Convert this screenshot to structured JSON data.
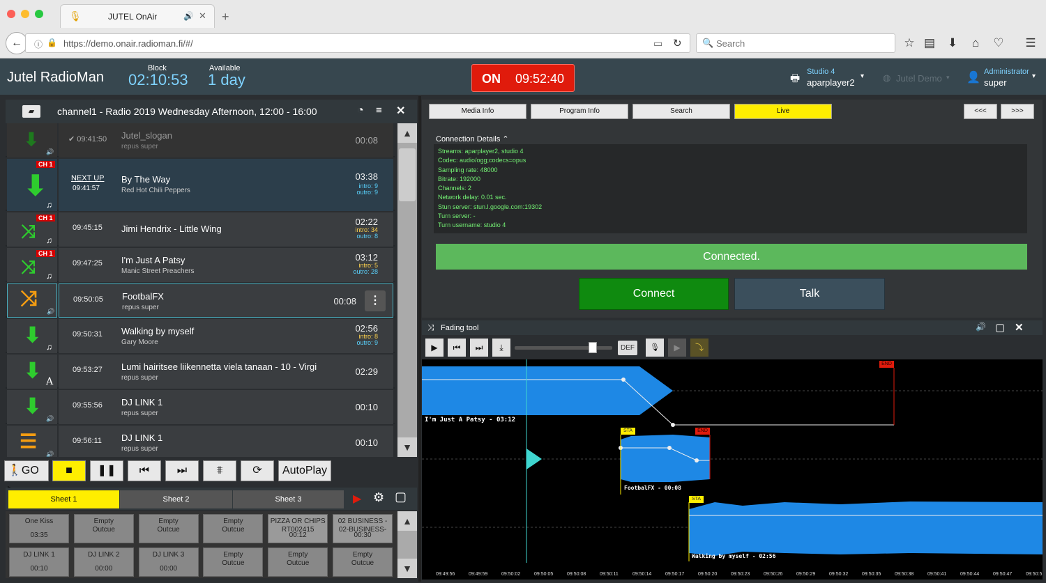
{
  "browser": {
    "tab_title": "JUTEL OnAir",
    "url": "https://demo.onair.radioman.fi/#/",
    "search_placeholder": "Search"
  },
  "header": {
    "brand": "Jutel RadioMan",
    "block_label": "Block",
    "block_value": "02:10:53",
    "available_label": "Available",
    "available_value": "1 day",
    "onair_label": "ON",
    "onair_time": "09:52:40",
    "studio_label": "Studio 4",
    "studio_value": "aparplayer2",
    "demo_label": "Jutel Demo",
    "user_label": "Administrator",
    "user_value": "super"
  },
  "playlist": {
    "title": "channel1 - Radio 2019 Wednesday Afternoon, 12:00 - 16:00",
    "ch_badge": "CH 1",
    "next_up": "NEXT UP",
    "rows": [
      {
        "time": "09:41:50",
        "title": "Jutel_slogan",
        "sub": "repus super",
        "dur": "00:08"
      },
      {
        "time": "09:41:57",
        "title": "By The Way",
        "sub": "Red Hot Chili Peppers",
        "dur": "03:38",
        "intro": "intro: 9",
        "outro": "outro: 9"
      },
      {
        "time": "09:45:15",
        "title": "Jimi Hendrix - Little Wing",
        "sub": "",
        "dur": "02:22",
        "intro": "intro: 34",
        "outro": "outro: 8"
      },
      {
        "time": "09:47:25",
        "title": "I'm Just A Patsy",
        "sub": "Manic Street Preachers",
        "dur": "03:12",
        "intro": "intro: 5",
        "outro": "outro: 28"
      },
      {
        "time": "09:50:05",
        "title": "FootbalFX",
        "sub": "repus super",
        "dur": "00:08"
      },
      {
        "time": "09:50:31",
        "title": "Walking by myself",
        "sub": "Gary Moore",
        "dur": "02:56",
        "intro": "intro: 8",
        "outro": "outro: 9"
      },
      {
        "time": "09:53:27",
        "title": "Lumi hairitsee liikennetta viela tanaan - 10 - Virgi",
        "sub": "repus super",
        "dur": "02:29"
      },
      {
        "time": "09:55:56",
        "title": "DJ LINK 1",
        "sub": "repus super",
        "dur": "00:10"
      },
      {
        "time": "09:56:11",
        "title": "DJ LINK 1",
        "sub": "repus super",
        "dur": "00:10"
      }
    ]
  },
  "transport": {
    "go": "GO",
    "autoplay": "AutoPlay"
  },
  "sheets": {
    "tabs": [
      "Sheet 1",
      "Sheet 2",
      "Sheet 3"
    ],
    "carts": [
      {
        "l1": "One Kiss",
        "l2": "",
        "t": "03:35"
      },
      {
        "l1": "Empty",
        "l2": "Outcue",
        "t": ""
      },
      {
        "l1": "Empty",
        "l2": "Outcue",
        "t": ""
      },
      {
        "l1": "Empty",
        "l2": "Outcue",
        "t": ""
      },
      {
        "l1": "PIZZA OR CHIPS",
        "l2": "RT002415",
        "t": "00:12"
      },
      {
        "l1": "02 BUSINESS -",
        "l2": "02-BUSINESS-",
        "t": "00:30"
      },
      {
        "l1": "DJ LINK 1",
        "l2": "",
        "t": "00:10"
      },
      {
        "l1": "DJ LINK 2",
        "l2": "",
        "t": "00:00"
      },
      {
        "l1": "DJ LINK 3",
        "l2": "",
        "t": "00:00"
      },
      {
        "l1": "Empty",
        "l2": "Outcue",
        "t": ""
      },
      {
        "l1": "Empty",
        "l2": "Outcue",
        "t": ""
      },
      {
        "l1": "Empty",
        "l2": "Outcue",
        "t": ""
      }
    ]
  },
  "right": {
    "tabs": [
      "Media Info",
      "Program Info",
      "Search",
      "Live"
    ],
    "prev": "<<<",
    "next": ">>>",
    "conn_title": "Connection Details",
    "conn_lines": [
      "Streams: aparplayer2, studio 4",
      "Codec: audio/ogg;codecs=opus",
      "Sampling rate: 48000",
      "Bitrate: 192000",
      "Channels: 2",
      "Network delay: 0.01 sec.",
      "Stun server: stun.l.google.com:19302",
      "Turn server: -",
      "Turn username: studio 4"
    ],
    "connected": "Connected.",
    "connect_btn": "Connect",
    "talk_btn": "Talk"
  },
  "fading": {
    "title": "Fading tool",
    "def": "DEF",
    "track1": "I'm Just A Patsy - 03:12",
    "track2": "FootbalFX - 00:08",
    "track3": "Walking by myself - 02:56",
    "sta": "STA",
    "end": "END",
    "ticks": [
      "09:49:56",
      "09:49:59",
      "09:50:02",
      "09:50:05",
      "09:50:08",
      "09:50:11",
      "09:50:14",
      "09:50:17",
      "09:50:20",
      "09:50:23",
      "09:50:26",
      "09:50:29",
      "09:50:32",
      "09:50:35",
      "09:50:38",
      "09:50:41",
      "09:50:44",
      "09:50:47",
      "09:50:5"
    ]
  },
  "colors": {
    "accent": "#7fd3ff",
    "onair": "#e01b0c",
    "live": "#ffee00",
    "green": "#0f8a0f",
    "wave": "#1e88e5"
  }
}
